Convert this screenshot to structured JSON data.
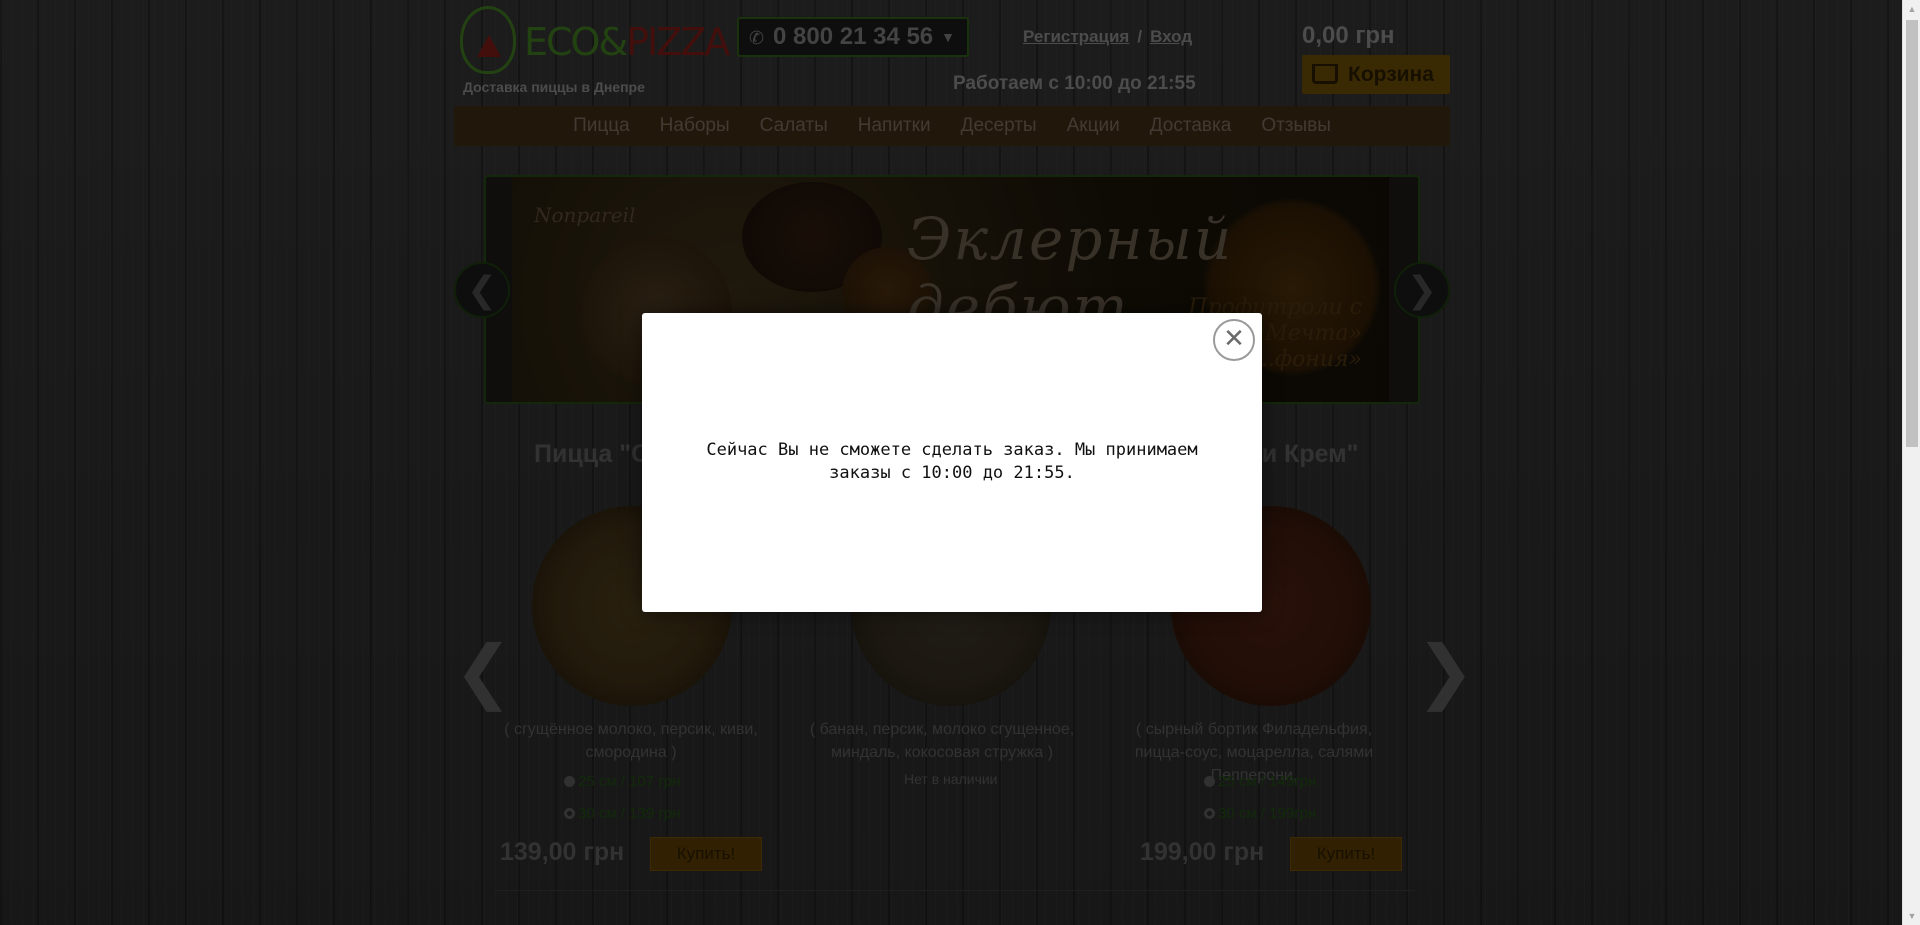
{
  "header": {
    "logo_eco": "ECO&",
    "logo_pizza": "PIZZA",
    "tagline": "Доставка пиццы в Днепре",
    "phone": "0 800 21 34 56",
    "register_label": "Регистрация",
    "separator": "/",
    "login_label": "Вход",
    "hours": "Работаем с 10:00 до 21:55",
    "cart_total": "0,00 грн",
    "cart_label": "Корзина"
  },
  "nav": {
    "items": [
      {
        "label": "Пицца"
      },
      {
        "label": "Наборы"
      },
      {
        "label": "Салаты"
      },
      {
        "label": "Напитки"
      },
      {
        "label": "Десерты"
      },
      {
        "label": "Акции"
      },
      {
        "label": "Доставка"
      },
      {
        "label": "Отзывы"
      }
    ]
  },
  "slider": {
    "brand": "Nonpareil",
    "title": "Эклерный дебют",
    "subtitle": "Профитроли с шоколаде «Мечта» «...фония»",
    "prev": "❮",
    "next": "❯"
  },
  "products": {
    "prev": "❮",
    "next": "❯",
    "items": [
      {
        "title": "Пицца \"С",
        "desc": "( сгущённое молоко, персик, киви, смородина )",
        "size1": "25 см / 107 грн",
        "size2": "30 см / 139 грн",
        "price": "139,00 грн",
        "buy": "Купить!"
      },
      {
        "title": "",
        "desc": "( банан, персик,  молоко сгущенное, миндаль, кокосовая стружка )",
        "status": "Нет в наличии"
      },
      {
        "title": "пперони Крем\"",
        "desc": "( сырный бортик Филадельфия, пицца-соус, моцарелла, салями Пепперони,",
        "size1": "25 см / 149грн",
        "size2": "30 см / 199грн",
        "price": "199,00 грн",
        "buy": "Купить!"
      }
    ]
  },
  "modal": {
    "message": "Сейчас Вы не сможете сделать заказ. Мы принимаем заказы с 10:00 до 21:55.",
    "close": "✕"
  },
  "colors": {
    "accent_green": "#2e5c18",
    "accent_orange": "#6b4d08",
    "nav_bg": "#3f2a14"
  }
}
